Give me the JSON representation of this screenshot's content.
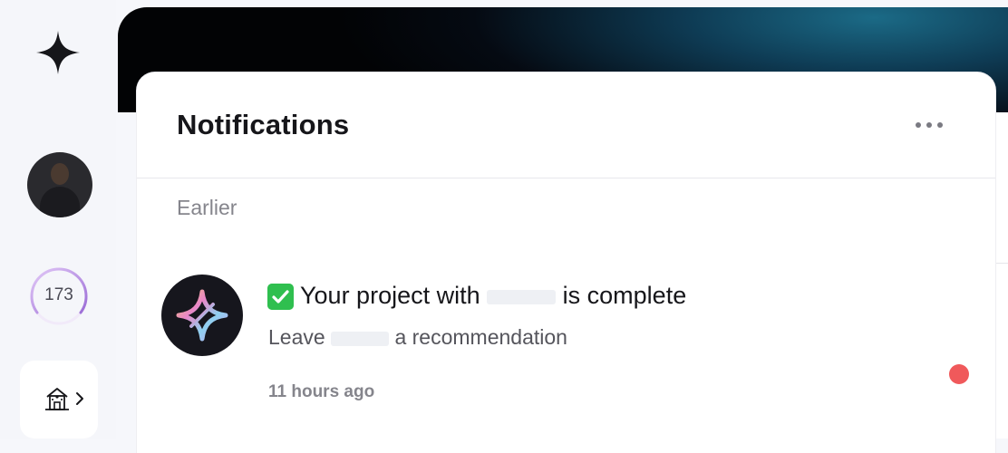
{
  "rail": {
    "logo_icon": "four-point-star-icon",
    "avatar_icon": "user-avatar",
    "score": "173",
    "score_colors": [
      "#d7b6f5",
      "#9b6cd6"
    ],
    "home_icon": "building-icon",
    "chevron_icon": "chevron-right-icon"
  },
  "panel": {
    "title": "Notifications",
    "more_icon": "more-horizontal-icon",
    "section_label": "Earlier"
  },
  "notification": {
    "avatar_icon": "brand-logo-icon",
    "status_icon": "check-mark-icon",
    "title_prefix": "Your project with",
    "title_suffix": "is complete",
    "subtitle_prefix": "Leave",
    "subtitle_suffix": "a recommendation",
    "time": "11 hours ago",
    "unread": true,
    "unread_color": "#f0595b"
  }
}
